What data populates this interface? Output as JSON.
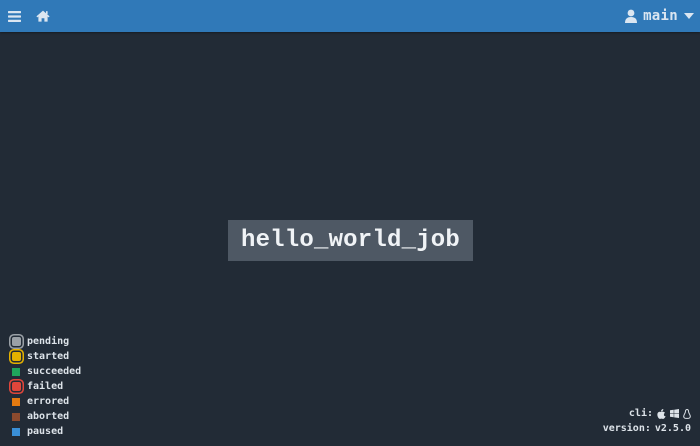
{
  "topbar": {
    "background": "#3079b8",
    "menu_icon": "hamburger-menu-icon",
    "home_icon": "home-icon",
    "user_icon": "user-icon",
    "team_name": "main",
    "dropdown_icon": "caret-down-icon"
  },
  "job": {
    "name": "hello_world_job"
  },
  "legend": {
    "items": [
      {
        "label": "pending",
        "color": "#9aa0a6",
        "ring": "#9aa0a6"
      },
      {
        "label": "started",
        "color": "#e4b100",
        "ring": "#e4b100"
      },
      {
        "label": "succeeded",
        "color": "#1fa55b"
      },
      {
        "label": "failed",
        "color": "#e0463b",
        "ring": "#e0463b"
      },
      {
        "label": "errored",
        "color": "#e47a10"
      },
      {
        "label": "aborted",
        "color": "#8b4a2e"
      },
      {
        "label": "paused",
        "color": "#3a8fd6"
      }
    ]
  },
  "footer": {
    "cli_label": "cli:",
    "cli_icons": [
      "apple-icon",
      "windows-icon",
      "linux-icon"
    ],
    "version_label": "version:",
    "version_value": "v2.5.0"
  }
}
